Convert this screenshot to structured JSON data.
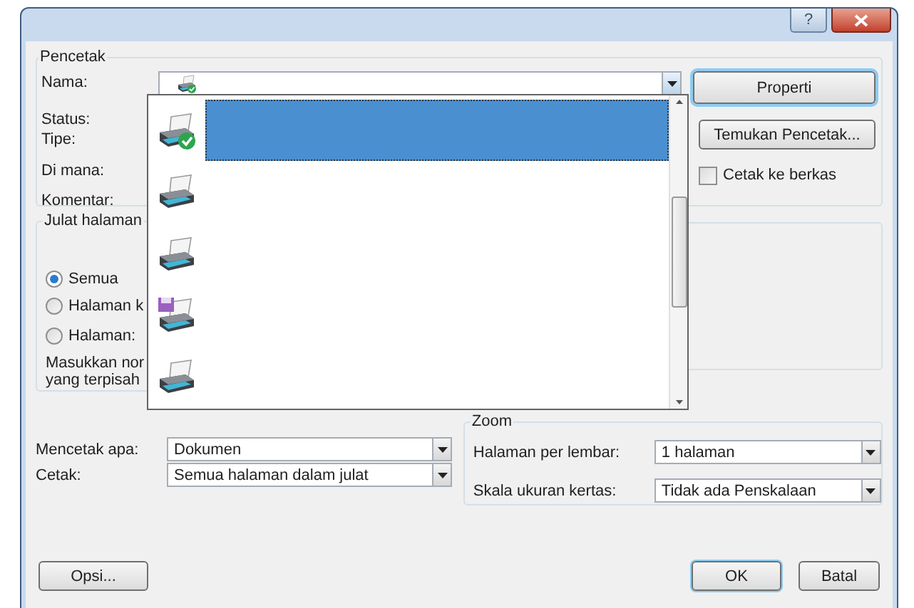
{
  "window": {
    "help_button": "?"
  },
  "printer": {
    "title": "Pencetak",
    "name_label": "Nama:",
    "status_label": "Status:",
    "type_label": "Tipe:",
    "where_label": "Di mana:",
    "comment_label": "Komentar:",
    "properties_button": "Properti",
    "find_button": "Temukan Pencetak...",
    "print_to_file": {
      "label": "Cetak ke berkas",
      "checked": false
    }
  },
  "printer_list": {
    "expanded": true,
    "items": [
      {
        "kind": "default",
        "selected": true
      },
      {
        "kind": "printer",
        "selected": false
      },
      {
        "kind": "printer",
        "selected": false
      },
      {
        "kind": "file",
        "selected": false
      },
      {
        "kind": "printer",
        "selected": false
      }
    ]
  },
  "page_range": {
    "title": "Julat halaman",
    "options": [
      {
        "label": "Semua",
        "selected": true
      },
      {
        "label": "Halaman k",
        "selected": false
      },
      {
        "label": "Halaman:",
        "selected": false
      }
    ],
    "hint_lines": [
      "Masukkan nor",
      "yang terpisah"
    ]
  },
  "print_what": {
    "label": "Mencetak apa:",
    "value": "Dokumen"
  },
  "print_range": {
    "label": "Cetak:",
    "value": "Semua halaman dalam julat"
  },
  "zoom": {
    "title": "Zoom",
    "pages_per_sheet": {
      "label": "Halaman per lembar:",
      "value": "1 halaman"
    },
    "scaling": {
      "label": "Skala ukuran kertas:",
      "value": "Tidak ada Penskalaan"
    }
  },
  "buttons": {
    "options": "Opsi...",
    "ok": "OK",
    "cancel": "Batal"
  }
}
